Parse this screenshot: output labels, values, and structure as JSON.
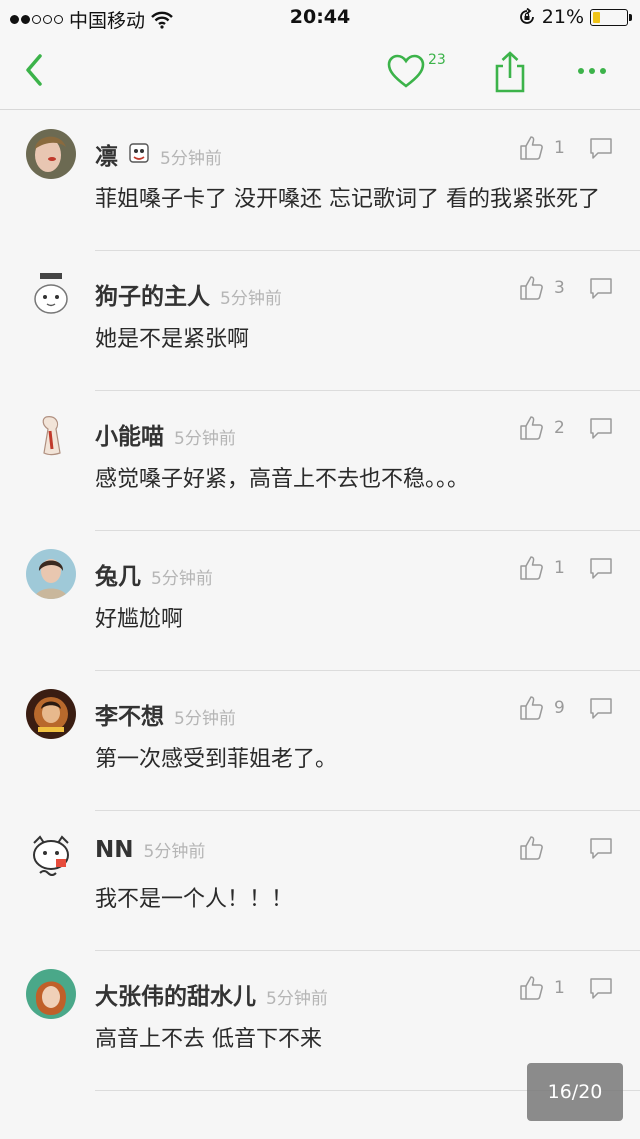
{
  "status_bar": {
    "carrier": "中国移动",
    "time": "20:44",
    "battery": "21%",
    "battery_level": 0.21
  },
  "nav": {
    "like_count": "23",
    "accent_color": "#3cb34a"
  },
  "comments": [
    {
      "name": "凛",
      "has_badge": true,
      "time": "5分钟前",
      "likes": "1",
      "text": "菲姐嗓子卡了 没开嗓还 忘记歌词了 看的我紧张死了"
    },
    {
      "name": "狗子的主人",
      "time": "5分钟前",
      "likes": "3",
      "text": "她是不是紧张啊"
    },
    {
      "name": "小能喵",
      "time": "5分钟前",
      "likes": "2",
      "text": "感觉嗓子好紧，高音上不去也不稳。。。"
    },
    {
      "name": "兔几",
      "time": "5分钟前",
      "likes": "1",
      "text": "好尴尬啊"
    },
    {
      "name": "李不想",
      "time": "5分钟前",
      "likes": "9",
      "text": "第一次感受到菲姐老了。"
    },
    {
      "name": "NN",
      "time": "5分钟前",
      "likes": "",
      "text": "我不是一个人！！！"
    },
    {
      "name": "大张伟的甜水儿",
      "time": "5分钟前",
      "likes": "1",
      "text": "高音上不去 低音下不来"
    }
  ],
  "page_indicator": "16/20"
}
